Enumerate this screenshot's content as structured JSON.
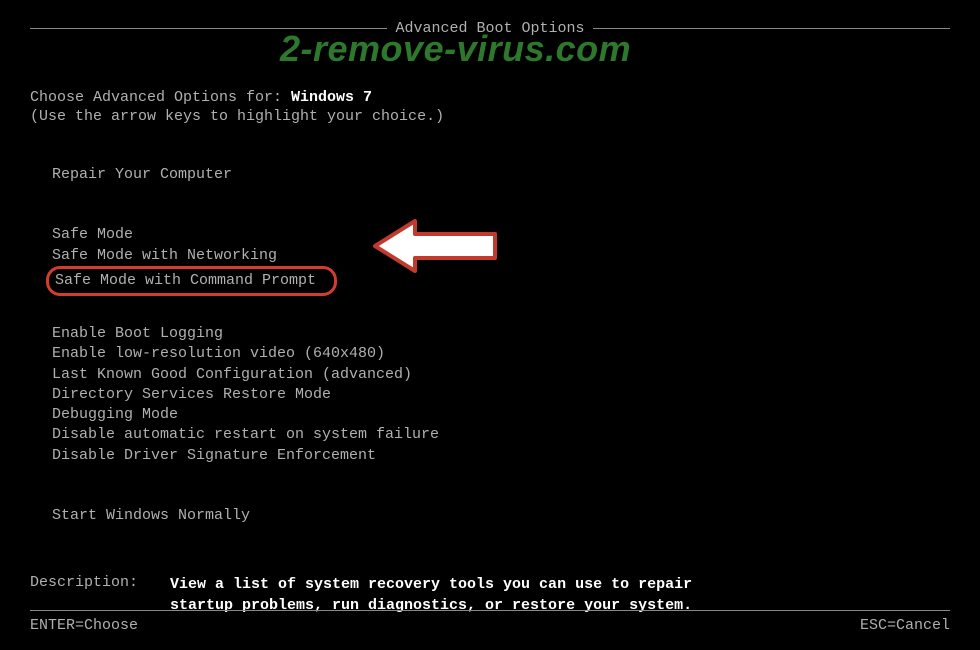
{
  "title": "Advanced Boot Options",
  "watermark": "2-remove-virus.com",
  "prompt_label": "Choose Advanced Options for: ",
  "os_name": "Windows 7",
  "hint": "(Use the arrow keys to highlight your choice.)",
  "group1": [
    "Repair Your Computer"
  ],
  "group2": {
    "items": [
      "Safe Mode",
      "Safe Mode with Networking",
      "Safe Mode with Command Prompt"
    ],
    "highlighted_index": 2
  },
  "group3": [
    "Enable Boot Logging",
    "Enable low-resolution video (640x480)",
    "Last Known Good Configuration (advanced)",
    "Directory Services Restore Mode",
    "Debugging Mode",
    "Disable automatic restart on system failure",
    "Disable Driver Signature Enforcement"
  ],
  "group4": [
    "Start Windows Normally"
  ],
  "description": {
    "label": "Description:",
    "text": "View a list of system recovery tools you can use to repair startup problems, run diagnostics, or restore your system."
  },
  "footer": {
    "enter": "ENTER=Choose",
    "esc": "ESC=Cancel"
  }
}
